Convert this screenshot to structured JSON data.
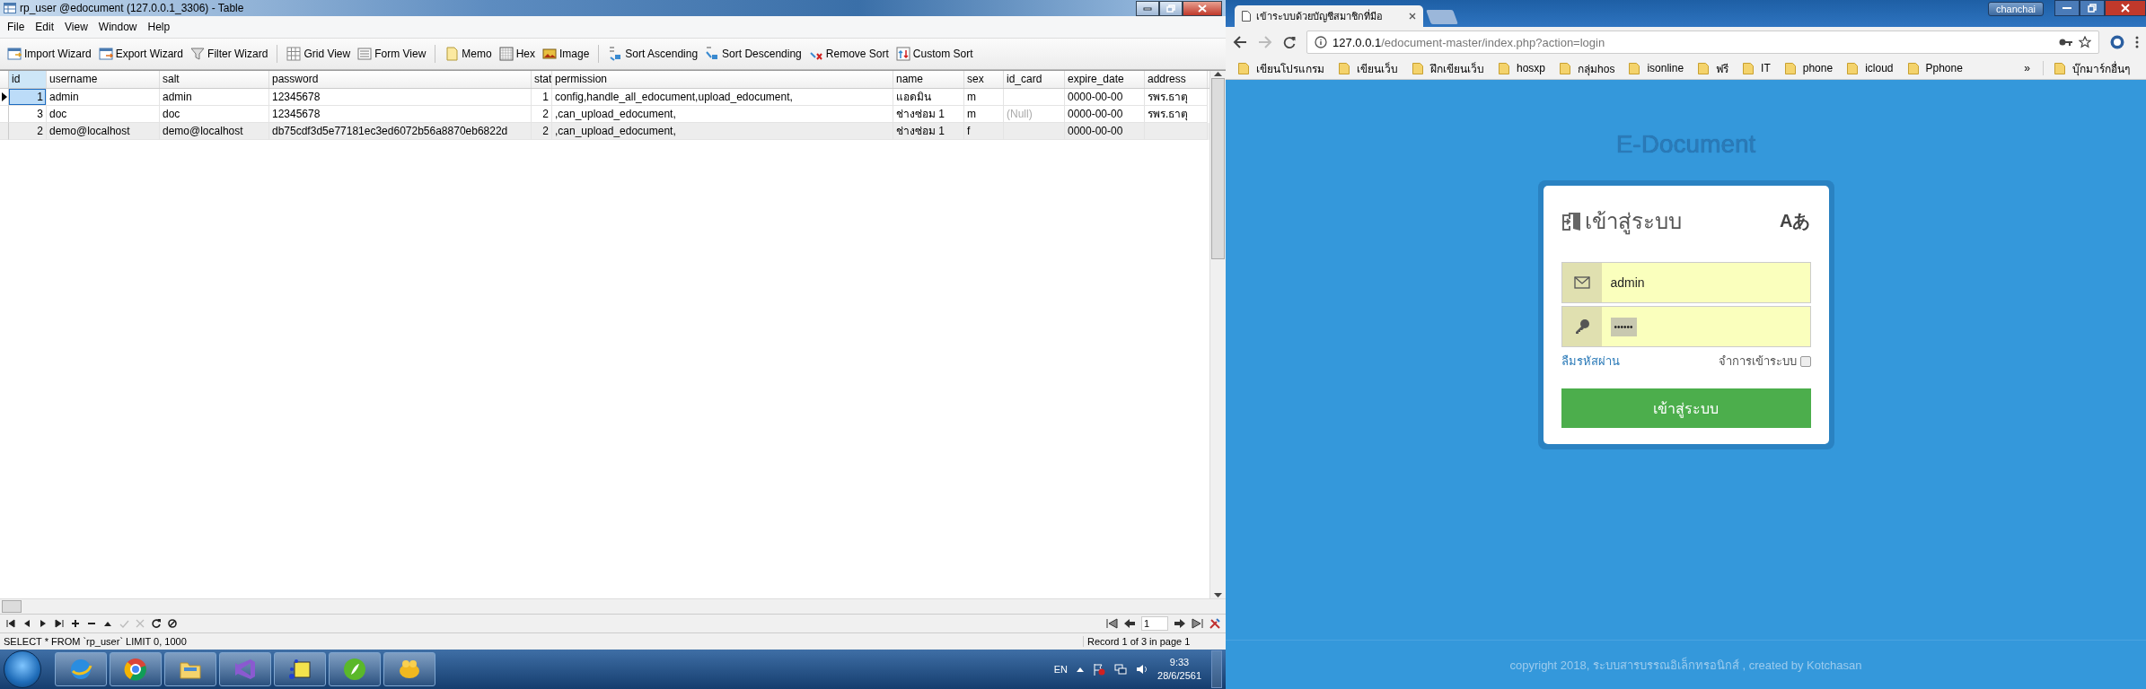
{
  "window": {
    "title": "rp_user @edocument (127.0.0.1_3306) - Table"
  },
  "menu": [
    {
      "label": "File"
    },
    {
      "label": "Edit"
    },
    {
      "label": "View"
    },
    {
      "label": "Window"
    },
    {
      "label": "Help"
    }
  ],
  "toolbar": [
    [
      {
        "label": "Import Wizard"
      },
      {
        "label": "Export Wizard"
      },
      {
        "label": "Filter Wizard"
      }
    ],
    [
      {
        "label": "Grid View"
      },
      {
        "label": "Form View"
      }
    ],
    [
      {
        "label": "Memo"
      },
      {
        "label": "Hex"
      },
      {
        "label": "Image"
      }
    ],
    [
      {
        "label": "Sort Ascending"
      },
      {
        "label": "Sort Descending"
      },
      {
        "label": "Remove Sort"
      },
      {
        "label": "Custom Sort"
      }
    ]
  ],
  "table": {
    "columns": [
      {
        "label": "id",
        "kind": "number"
      },
      {
        "label": "username",
        "kind": "text"
      },
      {
        "label": "salt",
        "kind": "text"
      },
      {
        "label": "password",
        "kind": "text"
      },
      {
        "label": "stat",
        "kind": "number"
      },
      {
        "label": "permission",
        "kind": "text"
      },
      {
        "label": "name",
        "kind": "text"
      },
      {
        "label": "sex",
        "kind": "text"
      },
      {
        "label": "id_card",
        "kind": "text"
      },
      {
        "label": "expire_date",
        "kind": "text"
      },
      {
        "label": "address",
        "kind": "text"
      }
    ],
    "rows": [
      {
        "selected": true,
        "shaded": false,
        "cells": [
          "1",
          "admin",
          "admin",
          "12345678",
          "1",
          "config,handle_all_edocument,upload_edocument,",
          "แอดมิน",
          "m",
          null,
          "0000-00-00",
          "รพร.ธาตุ"
        ]
      },
      {
        "selected": false,
        "shaded": false,
        "cells": [
          "3",
          "doc",
          "doc",
          "12345678",
          "2",
          ",can_upload_edocument,",
          "ช่างซ่อม 1",
          "m",
          {
            "text": "(Null)",
            "kind": "null"
          },
          "0000-00-00",
          "รพร.ธาตุ"
        ]
      },
      {
        "selected": false,
        "shaded": true,
        "cells": [
          "2",
          "demo@localhost",
          "demo@localhost",
          "db75cdf3d5e77181ec3ed6072b56a8870eb6822d",
          "2",
          ",can_upload_edocument,",
          "ช่างซ่อม 1",
          "f",
          null,
          "0000-00-00",
          null
        ]
      }
    ]
  },
  "nav": {
    "page": "1"
  },
  "status_bar": {
    "sql": "SELECT * FROM `rp_user` LIMIT 0, 1000",
    "record": "Record 1 of 3 in page 1"
  },
  "taskbar": {
    "lang": "EN",
    "time": "9:33",
    "date": "28/6/2561"
  },
  "browser": {
    "tab": {
      "title": "เข้าระบบด้วยบัญชีสมาชิกที่มีอ"
    },
    "user": "chanchai",
    "url": {
      "host": "127.0.0.1",
      "path": "/edocument-master/index.php?action=login"
    },
    "bookmarks": [
      {
        "label": "เขียนโปรแกรม"
      },
      {
        "label": "เขียนเว็บ"
      },
      {
        "label": "ฝึกเขียนเว็บ"
      },
      {
        "label": "hosxp"
      },
      {
        "label": "กลุ่มhos"
      },
      {
        "label": "isonline"
      },
      {
        "label": "ฟรี"
      },
      {
        "label": "IT"
      },
      {
        "label": "phone"
      },
      {
        "label": "icloud"
      },
      {
        "label": "Pphone"
      }
    ],
    "more": "»",
    "other_bookmarks": "บุ๊กมาร์กอื่นๆ"
  },
  "page": {
    "brand": "E-Document",
    "login": {
      "title": "เข้าสู่ระบบ",
      "lang": "Aあ",
      "email": "admin",
      "password": "••••••",
      "forgot": "ลืมรหัสผ่าน",
      "remember": {
        "label": "จำการเข้าระบบ",
        "checked": false
      },
      "submit": "เข้าสู่ระบบ"
    },
    "footer": "copyright 2018, ระบบสารบรรณอิเล็กทรอนิกส์ , created by Kotchasan"
  }
}
